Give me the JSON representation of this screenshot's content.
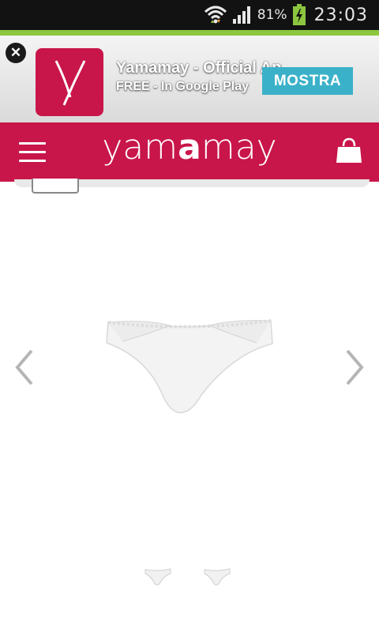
{
  "status_bar": {
    "battery_percent": "81%",
    "time": "23:03",
    "icons": [
      "wifi-icon",
      "signal-icon",
      "battery-charging-icon"
    ]
  },
  "app_banner": {
    "close_symbol": "✕",
    "title": "Yamamay - Official App",
    "subtitle": "FREE - In Google Play",
    "button_label": "MOSTRA",
    "icon_letter": "Y"
  },
  "header": {
    "brand_parts": [
      "yam",
      "a",
      "may"
    ]
  },
  "gallery": {
    "thumbnail_count": 2
  },
  "colors": {
    "brand": "#c8164a",
    "banner_button": "#3ab1c9",
    "status_green": "#8cc63f"
  }
}
